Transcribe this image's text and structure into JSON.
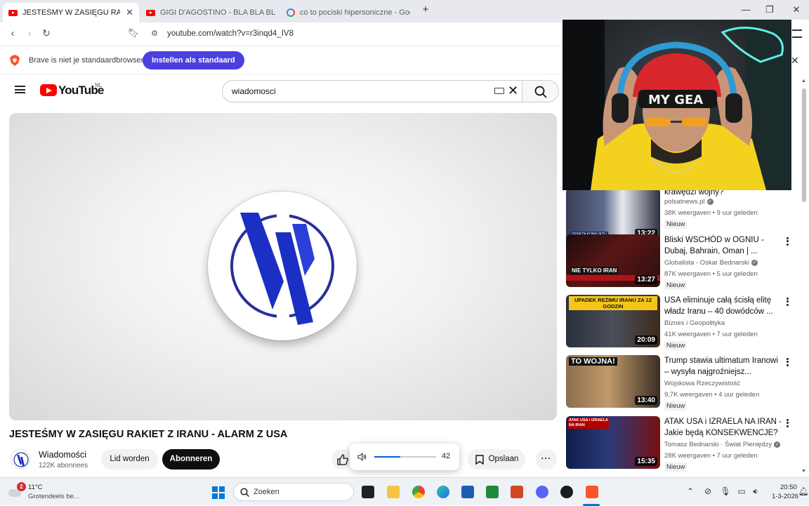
{
  "browser": {
    "tabs": [
      {
        "label": "JESTEŚMY W ZASIĘGU RAKIET Z",
        "active": true,
        "icon": "youtube-icon"
      },
      {
        "label": "GIGI D'AGOSTINO - BLA BLA BLA ( O",
        "active": false,
        "icon": "youtube-icon"
      },
      {
        "label": "co to pociski hipersoniczne - Google",
        "active": false,
        "icon": "google-icon"
      }
    ],
    "url": "youtube.com/watch?v=r3inqd4_IV8",
    "infobar_message": "Brave is niet je standaardbrowser",
    "infobar_button": "Instellen als standaard"
  },
  "youtube": {
    "logo_text": "YouTube",
    "country_code": "NL",
    "search_value": "wiadomosci"
  },
  "video": {
    "title": "JESTEŚMY W ZASIĘGU RAKIET Z IRANU - ALARM Z USA",
    "channel_name": "Wiadomości",
    "channel_subs": "122K abonnees",
    "join_label": "Lid worden",
    "subscribe_label": "Abonneren",
    "save_label": "Opslaan",
    "volume": 42
  },
  "recommendations": [
    {
      "title": "krawędzi wojny?",
      "channel": "polsatnews.pl",
      "verified": true,
      "meta": "38K weergaven • 9 uur geleden",
      "badge": "Nieuw",
      "duration": "13:22",
      "thumb_text": ""
    },
    {
      "title": "Bliski WSCHÓD w OGNIU - Dubaj, Bahrain, Oman | ...",
      "channel": "Globalista - Oskar Bednarski",
      "verified": true,
      "meta": "87K weergaven • 5 uur geleden",
      "badge": "Nieuw",
      "duration": "13:27",
      "thumb_text": "NIE TYLKO IRAN"
    },
    {
      "title": "USA eliminuje całą ścisłą elitę władz Iranu – 40 dowódców ...",
      "channel": "Biznes i Geopolityka",
      "verified": false,
      "meta": "41K weergaven • 7 uur geleden",
      "badge": "Nieuw",
      "duration": "20:09",
      "thumb_text": "UPADEK REŻIMU IRANU ZA 12 GODZIN"
    },
    {
      "title": "Trump stawia ultimatum Iranowi – wysyła najgroźniejsz...",
      "channel": "Wojskowa Rzeczywistość",
      "verified": false,
      "meta": "9,7K weergaven • 4 uur geleden",
      "badge": "Nieuw",
      "duration": "13:40",
      "thumb_text": "TO WOJNA!"
    },
    {
      "title": "ATAK USA i IZRAELA NA IRAN - Jakie będą KONSEKWENCJE?",
      "channel": "Tomasz Bednarski · Świat Pieniędzy",
      "verified": true,
      "meta": "28K weergaven • 7 uur geleden",
      "badge": "Nieuw",
      "duration": "15:35",
      "thumb_text": "ATAK USA i IZRAELA NA IRAN"
    }
  ],
  "taskbar": {
    "weather_temp": "11°C",
    "weather_desc": "Grotendeels be...",
    "notification_count": "2",
    "search_label": "Zoeken",
    "time": "20:50",
    "date": "1-3-2026"
  },
  "colors": {
    "yt_red": "#ff0000",
    "brave_button": "#4b3fe0",
    "wiadomosci_blue": "#1b2fc4"
  }
}
